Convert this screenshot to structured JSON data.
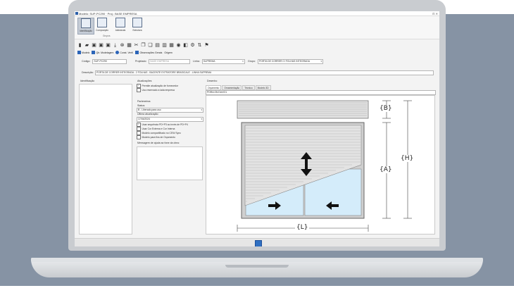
{
  "window": {
    "title": "Modelo: SUP-PC290 · Proj.: BASE EMPRESA",
    "controls": "⊡ ✕"
  },
  "ribbon": {
    "buttons": [
      "Identificação",
      "Composição",
      "Adicionais",
      "Estrutura"
    ],
    "group_label": "Grupos"
  },
  "toolbar2": {
    "items": [
      "Modelo",
      "Qtr. Modelagem",
      "Const. Verif.",
      "Observações Gerais",
      "Origem"
    ]
  },
  "header": {
    "codigo_label": "Código:",
    "codigo_value": "SUP-PC290",
    "projeto_label": "Projetado:",
    "projeto_value": "BASE EMPRESA",
    "linha_label": "Linha:",
    "linha_value": "SUPREMA",
    "grupo_label": "Grupo:",
    "grupo_value": "PORTA DE CORRER C/ FOLHAS INTEGRADA",
    "descricao_label": "Descrição:",
    "descricao_value": "PORTA DE CORRER INTEGRADA - 2 FOLHAS - BACENTE EXTRATORE BRASICALE - LINHA SUPREMA"
  },
  "left_panel": {
    "title": "Identificação"
  },
  "middle_panel": {
    "title": "Atualizações",
    "checks": [
      {
        "label": "Permite atualização de fornecedor",
        "checked": true
      },
      {
        "label": "Uso reservado a lada empresa",
        "checked": false
      }
    ],
    "params_title": "Parâmetros",
    "status_label": "Status:",
    "status_value": "B - Liberado para uso",
    "ultima_label": "Última atualização:",
    "ultima_value": "17/04/2024",
    "opts": [
      {
        "label": "Usar sequência PD+P3 ao invés de PD+P4",
        "checked": true
      },
      {
        "label": "Usar Cor Externa e Cor Interna",
        "checked": false
      },
      {
        "label": "Modelo compartilhado no CEW Sync",
        "checked": false
      },
      {
        "label": "Modelo para fins de Orçamento",
        "checked": false
      }
    ],
    "mensagem_label": "Mensagem de ajuda ao fone da obra:"
  },
  "right_panel": {
    "title": "Desenho",
    "tabs": [
      "Orçamento",
      "Ornamentação",
      "Técnico",
      "Modelo 3D"
    ],
    "subfield": "PORA ON DUVO1",
    "labels": {
      "B": "{B}",
      "A": "{A}",
      "H": "{H}",
      "L": "{L}"
    }
  },
  "colors": {
    "accent": "#2b64b8",
    "frame": "#8a8a8a",
    "glass": "#cde8f7",
    "shutter": "#dadada"
  }
}
